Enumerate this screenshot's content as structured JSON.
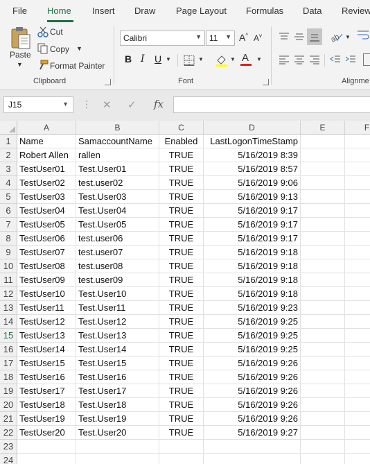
{
  "ribbon_tabs": [
    "File",
    "Home",
    "Insert",
    "Draw",
    "Page Layout",
    "Formulas",
    "Data",
    "Review"
  ],
  "clipboard": {
    "paste": "Paste",
    "cut": "Cut",
    "copy": "Copy",
    "format_painter": "Format Painter",
    "group_label": "Clipboard"
  },
  "font": {
    "name": "Calibri",
    "size": "11",
    "bold": "B",
    "italic": "I",
    "underline": "U",
    "group_label": "Font",
    "font_color": "#e02020",
    "highlight_color": "#ffff00"
  },
  "alignment": {
    "group_label": "Alignme"
  },
  "formula_bar": {
    "name_box": "J15",
    "fx": "fx",
    "value": ""
  },
  "columns": [
    "A",
    "B",
    "C",
    "D",
    "E",
    "F"
  ],
  "rows": [
    [
      "Name",
      "SamaccountName",
      "Enabled",
      "LastLogonTimeStamp"
    ],
    [
      "Robert Allen",
      "rallen",
      "TRUE",
      "5/16/2019 8:39"
    ],
    [
      "TestUser01",
      "Test.User01",
      "TRUE",
      "5/16/2019 8:57"
    ],
    [
      "TestUser02",
      "test.user02",
      "TRUE",
      "5/16/2019 9:06"
    ],
    [
      "TestUser03",
      "Test.User03",
      "TRUE",
      "5/16/2019 9:13"
    ],
    [
      "TestUser04",
      "Test.User04",
      "TRUE",
      "5/16/2019 9:17"
    ],
    [
      "TestUser05",
      "Test.User05",
      "TRUE",
      "5/16/2019 9:17"
    ],
    [
      "TestUser06",
      "test.user06",
      "TRUE",
      "5/16/2019 9:17"
    ],
    [
      "TestUser07",
      "test.user07",
      "TRUE",
      "5/16/2019 9:18"
    ],
    [
      "TestUser08",
      "test.user08",
      "TRUE",
      "5/16/2019 9:18"
    ],
    [
      "TestUser09",
      "test.user09",
      "TRUE",
      "5/16/2019 9:18"
    ],
    [
      "TestUser10",
      "Test.User10",
      "TRUE",
      "5/16/2019 9:18"
    ],
    [
      "TestUser11",
      "Test.User11",
      "TRUE",
      "5/16/2019 9:23"
    ],
    [
      "TestUser12",
      "Test.User12",
      "TRUE",
      "5/16/2019 9:25"
    ],
    [
      "TestUser13",
      "Test.User13",
      "TRUE",
      "5/16/2019 9:25"
    ],
    [
      "TestUser14",
      "Test.User14",
      "TRUE",
      "5/16/2019 9:25"
    ],
    [
      "TestUser15",
      "Test.User15",
      "TRUE",
      "5/16/2019 9:26"
    ],
    [
      "TestUser16",
      "Test.User16",
      "TRUE",
      "5/16/2019 9:26"
    ],
    [
      "TestUser17",
      "Test.User17",
      "TRUE",
      "5/16/2019 9:26"
    ],
    [
      "TestUser18",
      "Test.User18",
      "TRUE",
      "5/16/2019 9:26"
    ],
    [
      "TestUser19",
      "Test.User19",
      "TRUE",
      "5/16/2019 9:26"
    ],
    [
      "TestUser20",
      "Test.User20",
      "TRUE",
      "5/16/2019 9:27"
    ],
    [
      "",
      "",
      "",
      ""
    ],
    [
      "",
      "",
      "",
      ""
    ]
  ],
  "row_numbers": [
    "1",
    "2",
    "3",
    "4",
    "5",
    "6",
    "7",
    "8",
    "9",
    "10",
    "11",
    "12",
    "13",
    "14",
    "15",
    "16",
    "17",
    "18",
    "19",
    "20",
    "21",
    "22",
    "23",
    "24"
  ],
  "active_row": "15",
  "accent_color": "#1e7145"
}
